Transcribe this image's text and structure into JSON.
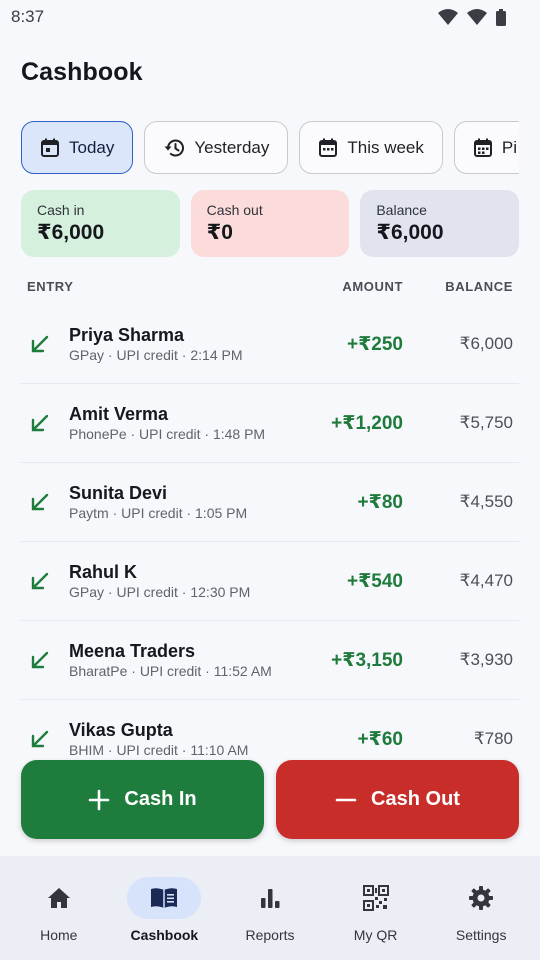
{
  "status_bar": {
    "time": "8:37"
  },
  "app": {
    "title": "Cashbook"
  },
  "filters": [
    {
      "label": "Today",
      "active": true,
      "icon": "calendar-icon"
    },
    {
      "label": "Yesterday",
      "active": false,
      "icon": "history-icon"
    },
    {
      "label": "This week",
      "active": false,
      "icon": "calendar-icon"
    },
    {
      "label": "Pi",
      "active": false,
      "icon": "calendar-icon"
    }
  ],
  "summary": {
    "cash_in": {
      "label": "Cash in",
      "value": "₹6,000"
    },
    "cash_out": {
      "label": "Cash out",
      "value": "₹0"
    },
    "balance": {
      "label": "Balance",
      "value": "₹6,000"
    }
  },
  "table": {
    "headers": {
      "entry": "ENTRY",
      "amount": "AMOUNT",
      "balance": "BALANCE"
    },
    "rows": [
      {
        "name": "Priya Sharma",
        "meta": "GPay · UPI credit · 2:14 PM",
        "amount": "+₹250",
        "balance": "₹6,000"
      },
      {
        "name": "Amit Verma",
        "meta": "PhonePe · UPI credit · 1:48 PM",
        "amount": "+₹1,200",
        "balance": "₹5,750"
      },
      {
        "name": "Sunita Devi",
        "meta": "Paytm · UPI credit · 1:05 PM",
        "amount": "+₹80",
        "balance": "₹4,550"
      },
      {
        "name": "Rahul K",
        "meta": "GPay · UPI credit · 12:30 PM",
        "amount": "+₹540",
        "balance": "₹4,470"
      },
      {
        "name": "Meena Traders",
        "meta": "BharatPe · UPI credit · 11:52 AM",
        "amount": "+₹3,150",
        "balance": "₹3,930"
      },
      {
        "name": "Vikas Gupta",
        "meta": "BHIM · UPI credit · 11:10 AM",
        "amount": "+₹60",
        "balance": "₹780"
      }
    ]
  },
  "actions": {
    "cash_in": "Cash In",
    "cash_out": "Cash Out"
  },
  "nav": [
    {
      "label": "Home",
      "icon": "home-icon",
      "active": false
    },
    {
      "label": "Cashbook",
      "icon": "book-icon",
      "active": true
    },
    {
      "label": "Reports",
      "icon": "bar-chart-icon",
      "active": false
    },
    {
      "label": "My QR",
      "icon": "qr-code-icon",
      "active": false
    },
    {
      "label": "Settings",
      "icon": "gear-icon",
      "active": false
    }
  ],
  "colors": {
    "accent": "#2f61c9",
    "positive": "#1e7d3c",
    "negative": "#c92d2a"
  }
}
